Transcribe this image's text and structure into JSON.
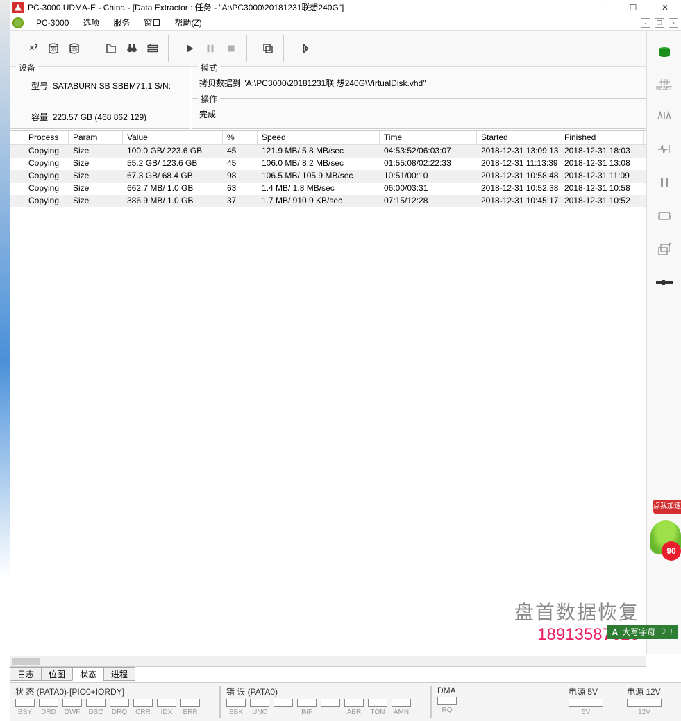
{
  "title": "PC-3000 UDMA-E - China - [Data Extractor : 任务 - \"A:\\PC3000\\20181231联想240G\"]",
  "menu": {
    "app": "PC-3000",
    "items": [
      "选项",
      "服务",
      "窗口",
      "帮助(Z)"
    ]
  },
  "info": {
    "device_legend": "设备",
    "model_label": "型号",
    "model_value": "SATABURN  SB SBBM71.1 S/N:",
    "capacity_label": "容量",
    "capacity_value": "223.57 GB (468 862 129)",
    "mode_legend": "模式",
    "mode_value": "拷贝数据到 \"A:\\PC3000\\20181231联 想240G\\VirtualDisk.vhd\"",
    "op_legend": "操作",
    "op_value": "完成"
  },
  "table": {
    "headers": [
      "Process",
      "Param",
      "Value",
      "%",
      "Speed",
      "Time",
      "Started",
      "Finished"
    ],
    "rows": [
      {
        "process": "Copying",
        "param": "Size",
        "value": "100.0 GB/ 223.6 GB",
        "pct": "45",
        "speed": "121.9 MB/ 5.8 MB/sec",
        "time": "04:53:52/06:03:07",
        "started": "2018-12-31 13:09:13",
        "finished": "2018-12-31 18:03"
      },
      {
        "process": "Copying",
        "param": "Size",
        "value": "55.2 GB/ 123.6 GB",
        "pct": "45",
        "speed": "106.0 MB/ 8.2 MB/sec",
        "time": "01:55:08/02:22:33",
        "started": "2018-12-31 11:13:39",
        "finished": "2018-12-31 13:08"
      },
      {
        "process": "Copying",
        "param": "Size",
        "value": "67.3 GB/ 68.4 GB",
        "pct": "98",
        "speed": "106.5 MB/ 105.9 MB/sec",
        "time": "10:51/00:10",
        "started": "2018-12-31 10:58:48",
        "finished": "2018-12-31 11:09"
      },
      {
        "process": "Copying",
        "param": "Size",
        "value": "662.7 MB/ 1.0 GB",
        "pct": "63",
        "speed": "1.4 MB/ 1.8 MB/sec",
        "time": "06:00/03:31",
        "started": "2018-12-31 10:52:38",
        "finished": "2018-12-31 10:58"
      },
      {
        "process": "Copying",
        "param": "Size",
        "value": "386.9 MB/ 1.0 GB",
        "pct": "37",
        "speed": "1.7 MB/ 910.9 KB/sec",
        "time": "07:15/12:28",
        "started": "2018-12-31 10:45:17",
        "finished": "2018-12-31 10:52"
      }
    ]
  },
  "tabs": [
    "日志",
    "位图",
    "状态",
    "进程"
  ],
  "active_tab_index": 2,
  "status": {
    "pata_label": "状 态 (PATA0)-[PIO0+IORDY]",
    "pata_leds": [
      "BSY",
      "DRD",
      "DWF",
      "DSC",
      "DRQ",
      "CRR",
      "IDX",
      "ERR"
    ],
    "err_label": "错 误 (PATA0)",
    "err_leds": [
      "BBK",
      "UNC",
      "",
      "INF",
      "",
      "ABR",
      "TON",
      "AMN"
    ],
    "dma_label": "DMA",
    "dma_leds": [
      "RQ"
    ],
    "pwr5_label": "电源 5V",
    "pwr5_led": "5V",
    "pwr12_label": "电源 12V",
    "pwr12_led": "12V"
  },
  "widgets": {
    "speed_badge": "点我加速",
    "red_circle": "90",
    "ime_text": "大写字母"
  },
  "watermark": {
    "title": "盘首数据恢复",
    "phone": "18913587620"
  },
  "right_toolbar_labels": [
    "RESET"
  ]
}
